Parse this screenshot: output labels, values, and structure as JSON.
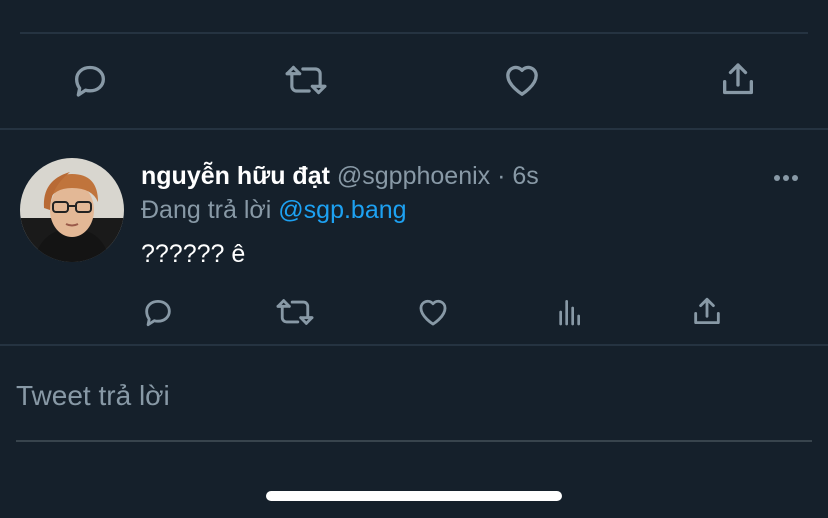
{
  "prev_tweet": {
    "truncated_text": "· · ·"
  },
  "icons": {
    "reply": "reply-icon",
    "retweet": "retweet-icon",
    "like": "heart-icon",
    "share": "share-icon",
    "analytics": "analytics-icon",
    "more": "more-icon"
  },
  "reply_tweet": {
    "display_name": "nguyễn hữu đạt",
    "handle": "@sgpphoenix",
    "separator": " · ",
    "time": "6s",
    "replying_prefix": "Đang trả lời ",
    "replying_to": "@sgp.bang",
    "text": "?????? ê"
  },
  "composer": {
    "placeholder": "Tweet trả lời"
  },
  "colors": {
    "background": "#15202b",
    "secondary_text": "#8899a6",
    "accent": "#1da1f2",
    "divider": "#253341"
  }
}
